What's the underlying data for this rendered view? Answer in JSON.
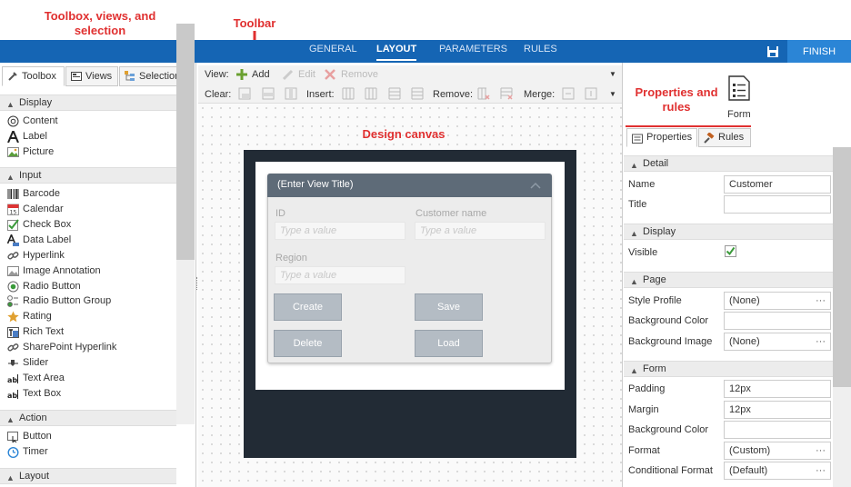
{
  "annotations": {
    "toolbox": "Toolbox, views, and selection",
    "toolbar": "Toolbar",
    "canvas": "Design canvas",
    "properties": "Properties and rules"
  },
  "nav": {
    "tabs": [
      "GENERAL",
      "LAYOUT",
      "PARAMETERS",
      "RULES"
    ],
    "active": "LAYOUT",
    "finish": "FINISH"
  },
  "left_panel": {
    "tabs": [
      "Toolbox",
      "Views",
      "Selection"
    ],
    "sections": [
      {
        "title": "Display",
        "items": [
          "Content",
          "Label",
          "Picture"
        ]
      },
      {
        "title": "Input",
        "items": [
          "Barcode",
          "Calendar",
          "Check Box",
          "Data Label",
          "Hyperlink",
          "Image Annotation",
          "Radio Button",
          "Radio Button Group",
          "Rating",
          "Rich Text",
          "SharePoint Hyperlink",
          "Slider",
          "Text Area",
          "Text Box"
        ]
      },
      {
        "title": "Action",
        "items": [
          "Button",
          "Timer"
        ]
      },
      {
        "title": "Layout",
        "items": []
      }
    ]
  },
  "toolbar": {
    "view_label": "View:",
    "add": "Add",
    "edit": "Edit",
    "remove": "Remove",
    "clear_label": "Clear:",
    "insert_label": "Insert:",
    "remove_label": "Remove:",
    "merge_label": "Merge:"
  },
  "view": {
    "title": "(Enter View Title)",
    "fields": [
      {
        "label": "ID",
        "placeholder": "Type a value"
      },
      {
        "label": "Customer name",
        "placeholder": "Type a value"
      },
      {
        "label": "Region",
        "placeholder": "Type a value"
      }
    ],
    "buttons": [
      "Create",
      "Save",
      "Delete",
      "Load"
    ]
  },
  "right_panel": {
    "form_label": "Form",
    "tabs": [
      "Properties",
      "Rules"
    ],
    "detail": {
      "title": "Detail",
      "name_label": "Name",
      "name_value": "Customer",
      "title_label": "Title",
      "title_value": ""
    },
    "display": {
      "title": "Display",
      "visible_label": "Visible",
      "visible_checked": true
    },
    "page": {
      "title": "Page",
      "style_profile_label": "Style Profile",
      "style_profile_value": "(None)",
      "bg_color_label": "Background Color",
      "bg_image_label": "Background Image",
      "bg_image_value": "(None)"
    },
    "form": {
      "title": "Form",
      "padding_label": "Padding",
      "padding_value": "12px",
      "margin_label": "Margin",
      "margin_value": "12px",
      "bg_color_label": "Background Color",
      "format_label": "Format",
      "format_value": "(Custom)",
      "cond_format_label": "Conditional Format",
      "cond_format_value": "(Default)"
    }
  },
  "colors": {
    "accent": "#1565b4",
    "annotation": "#e03030",
    "finish": "#2b85d6"
  }
}
